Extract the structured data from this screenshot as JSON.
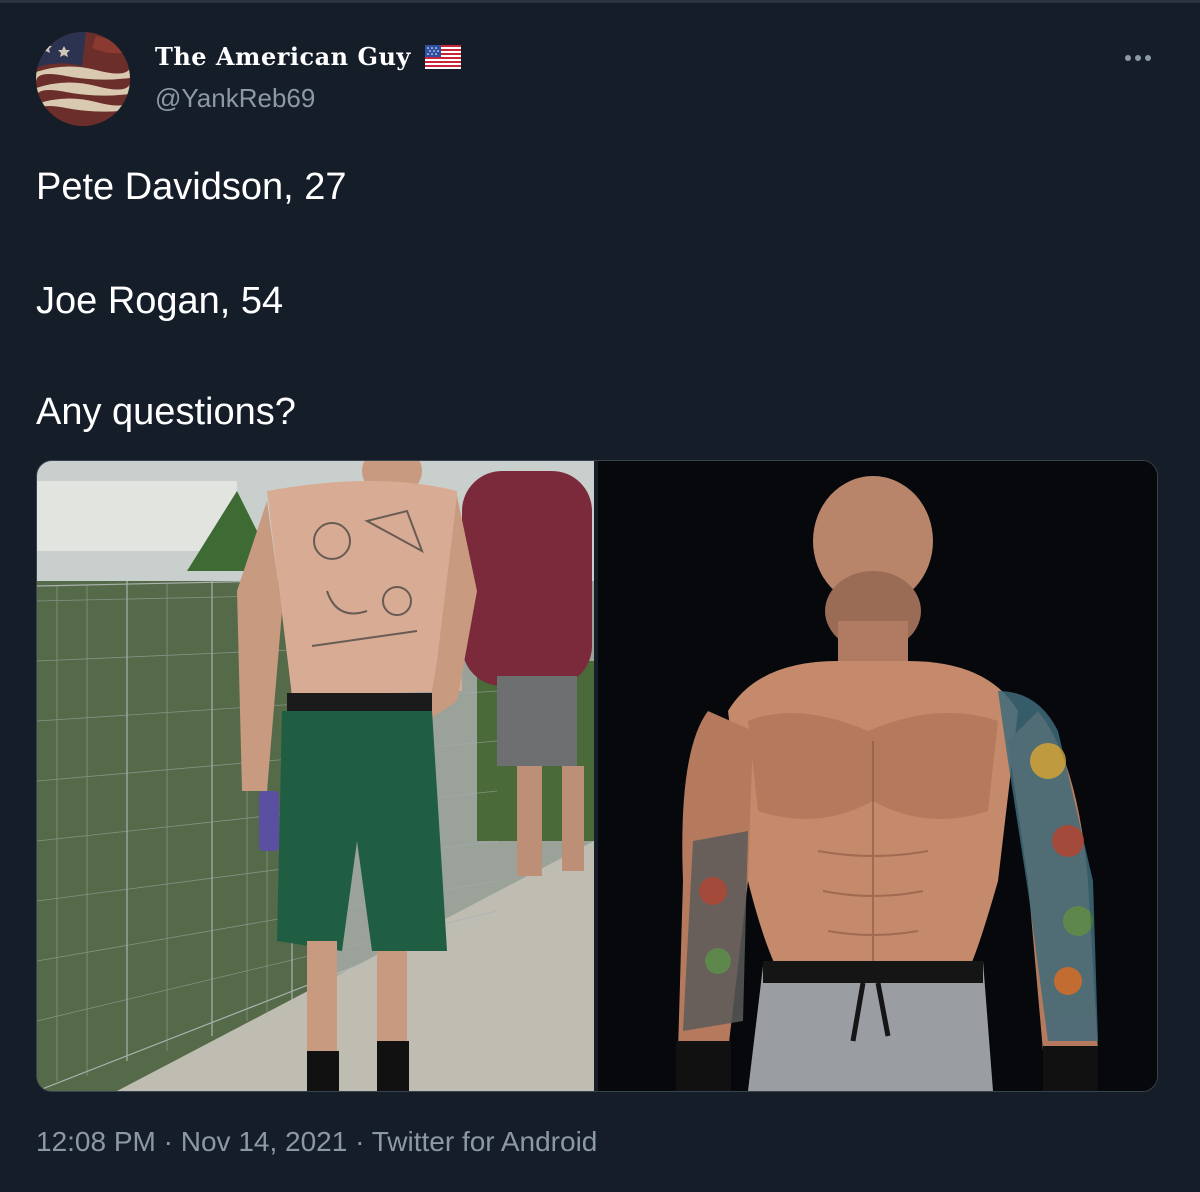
{
  "author": {
    "display_name": "The American Guy",
    "handle": "@YankReb69",
    "avatar_icon": "american-flag-avatar",
    "badge_icon": "us-flag-icon"
  },
  "tweet": {
    "lines": [
      "Pete Davidson, 27",
      "Joe Rogan, 54",
      "Any questions?"
    ]
  },
  "media": {
    "left_photo": "shirtless tattooed man walking on sidewalk",
    "right_photo": "muscular shirtless tattooed man on black background"
  },
  "meta": {
    "time": "12:08 PM",
    "separator": "·",
    "date": "Nov 14, 2021",
    "source": "Twitter for Android"
  },
  "colors": {
    "background": "#151d28",
    "text": "#ffffff",
    "muted": "#8b98a5"
  }
}
